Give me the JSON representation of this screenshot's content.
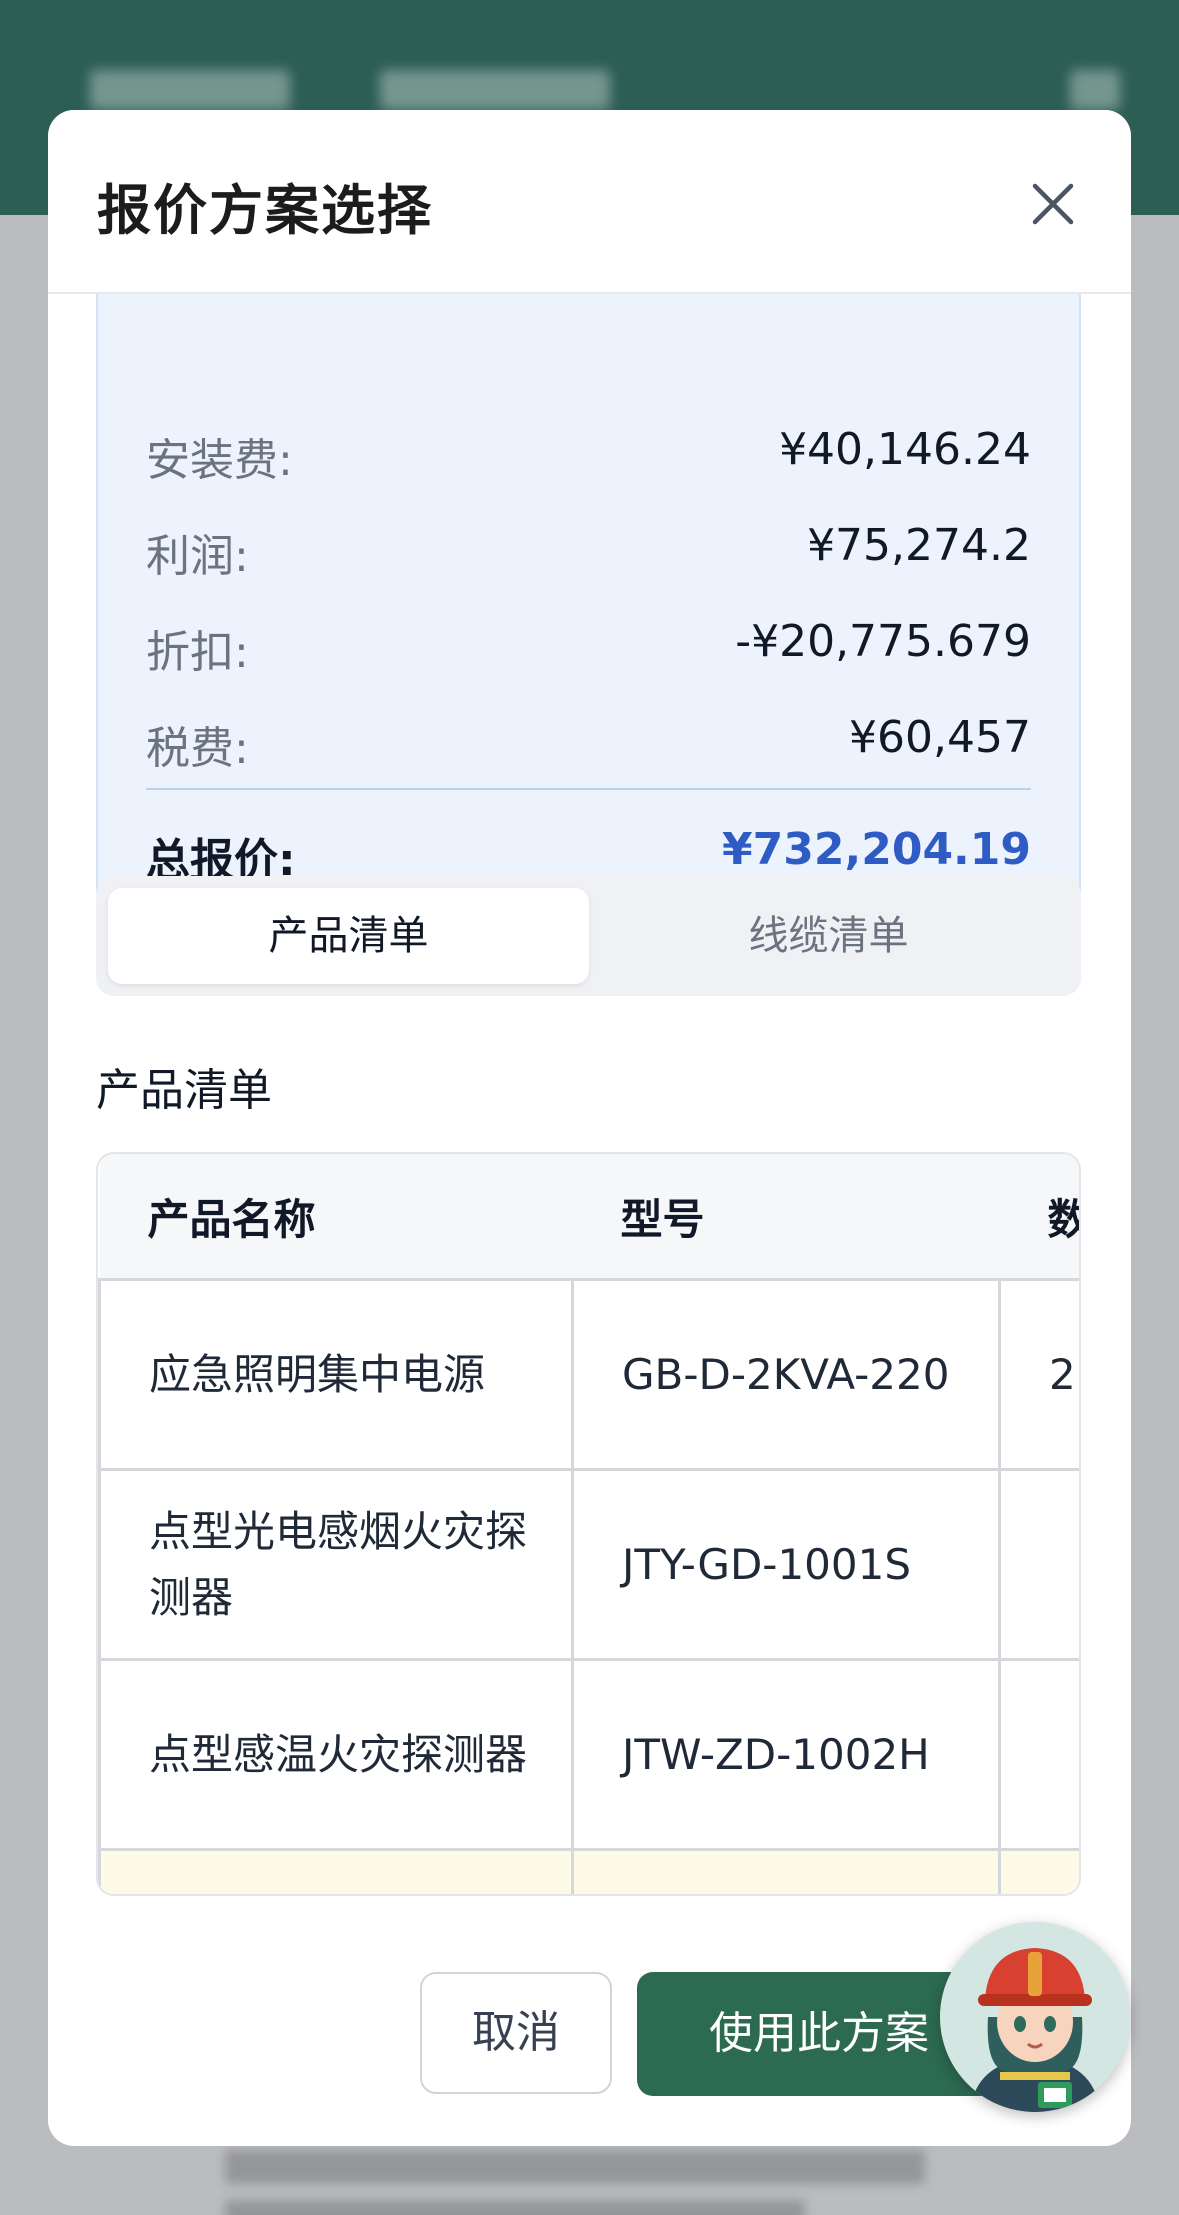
{
  "modal": {
    "title": "报价方案选择"
  },
  "summary": {
    "rows": [
      {
        "label": "安装费:",
        "value": "¥40,146.24"
      },
      {
        "label": "利润:",
        "value": "¥75,274.2"
      },
      {
        "label": "折扣:",
        "value": "-¥20,775.679"
      },
      {
        "label": "税费:",
        "value": "¥60,457"
      }
    ],
    "total": {
      "label": "总报价:",
      "value": "¥732,204.19"
    }
  },
  "tabs": [
    {
      "label": "产品清单",
      "active": true
    },
    {
      "label": "线缆清单",
      "active": false
    }
  ],
  "section_title": "产品清单",
  "table": {
    "headers": [
      "产品名称",
      "型号",
      "数"
    ],
    "rows": [
      {
        "name": "应急照明集中电源",
        "model": "GB-D-2KVA-220",
        "qty": "2"
      },
      {
        "name": "点型光电感烟火灾探测器",
        "model": "JTY-GD-1001S",
        "qty": ""
      },
      {
        "name": "点型感温火灾探测器",
        "model": "JTW-ZD-1002H",
        "qty": ""
      }
    ]
  },
  "buttons": {
    "cancel": "取消",
    "use": "使用此方案"
  },
  "colors": {
    "header_bg": "#2c5e54",
    "primary": "#2c6a52",
    "total_accent": "#2f5bc4",
    "summary_bg": "#ecf3fd"
  },
  "icons": {
    "close": "close-icon",
    "assistant": "firefighter-avatar-icon"
  }
}
